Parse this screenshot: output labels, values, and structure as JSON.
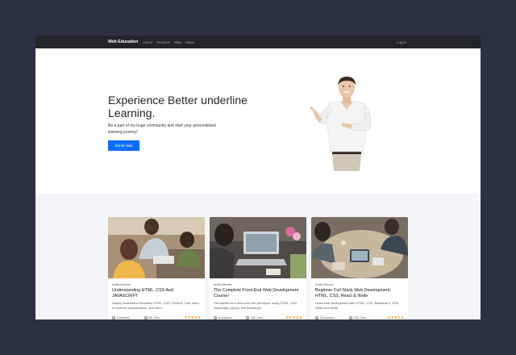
{
  "nav": {
    "brand": "Web Education",
    "links": [
      "Home",
      "Services",
      "Blog",
      "About"
    ],
    "login": "Log In"
  },
  "hero": {
    "title": "Experience Better underline Learning.",
    "subtitle": "Be a part of my huge community and start your personalized learning journey!",
    "cta": "Enroll Now"
  },
  "courses": [
    {
      "author": "Anita Mercer",
      "title": "Understanding HTML, CSS And JAVASCRIPT",
      "description": "Deeply understand Semantic HTML, CSS, Flexbox, Grid, learn to read the specifications, and more.",
      "lessons": "5 lessons",
      "hours": "8h 12m",
      "rating": "★★★★★"
    },
    {
      "author": "Anita Mercer",
      "title": "The Complete Front-End Web Development Course!",
      "description": "Get started as a front-end web developer using HTML, CSS, JavaScript, jQuery, and Bootstrap!",
      "lessons": "8 lessons",
      "hours": "40h 19m",
      "rating": "★★★★★"
    },
    {
      "author": "Anita Mercer",
      "title": "Beginner Full Stack Web Development: HTML, CSS, React & Node",
      "description": "Learn web development with HTML, CSS, Bootstrap 4, ES6 React and Node",
      "lessons": "23 lessons",
      "hours": "33h 20m",
      "rating": "★★★★★"
    }
  ],
  "colors": {
    "background": "#2b3045",
    "navbar": "#212529",
    "primary": "#0d6efd",
    "section": "#f3f5f9",
    "star": "#f5a623"
  }
}
